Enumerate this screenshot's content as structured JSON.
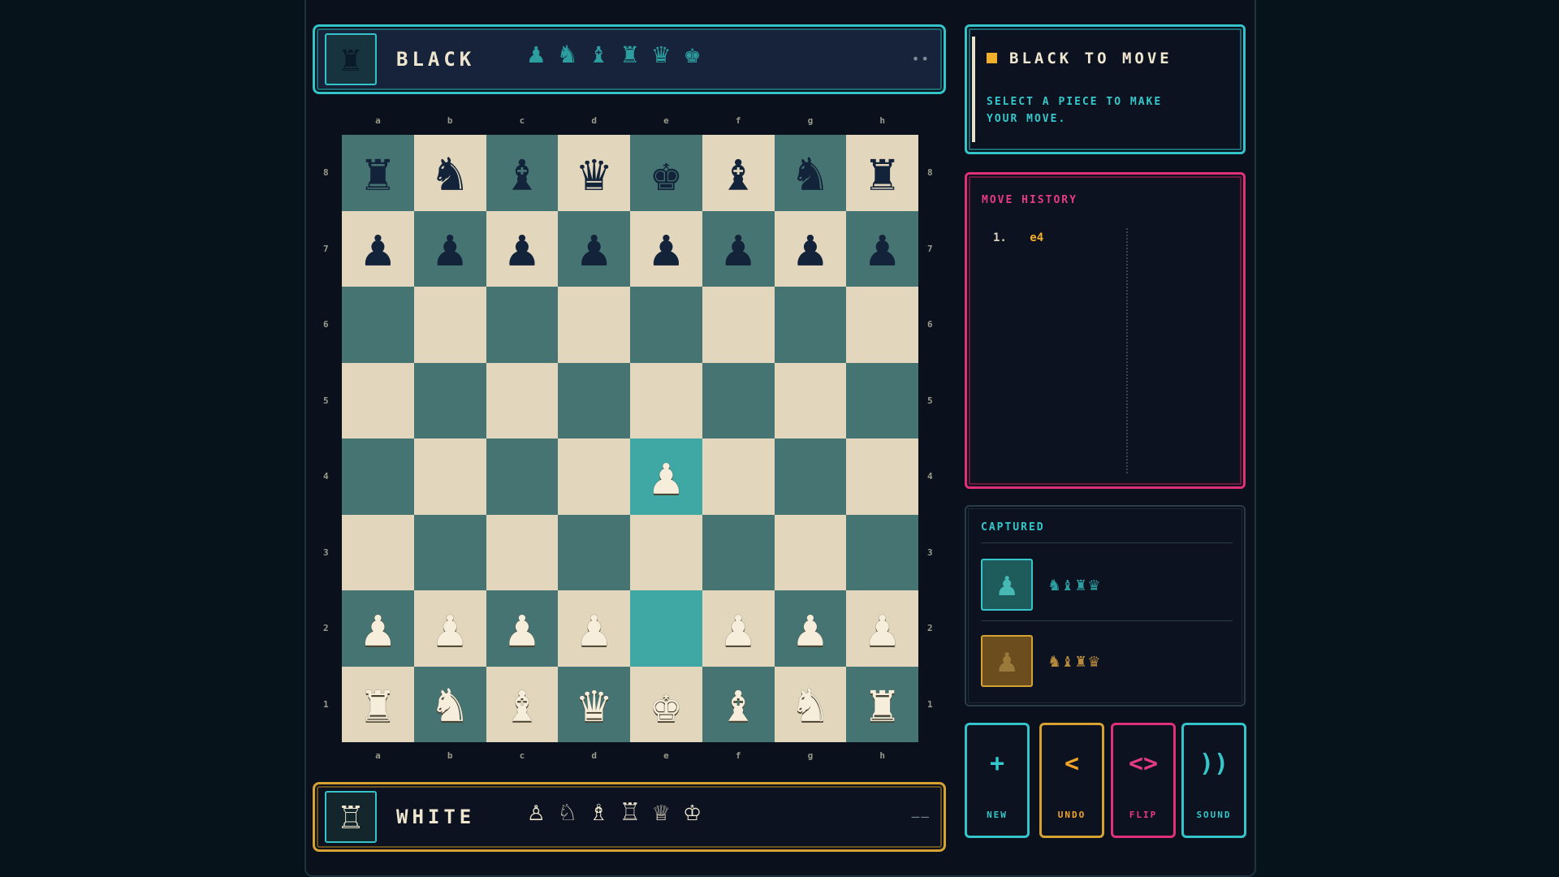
{
  "black_player": {
    "name": "BLACK",
    "avatar": "♜",
    "pieces": [
      "♟",
      "♞",
      "♝",
      "♜",
      "♛",
      "♚"
    ],
    "clock": "••"
  },
  "white_player": {
    "name": "WHITE",
    "avatar": "♖",
    "pieces": [
      "♙",
      "♘",
      "♗",
      "♖",
      "♕",
      "♔"
    ],
    "clock": "——"
  },
  "board": {
    "files": [
      "a",
      "b",
      "c",
      "d",
      "e",
      "f",
      "g",
      "h"
    ],
    "ranks": [
      "8",
      "7",
      "6",
      "5",
      "4",
      "3",
      "2",
      "1"
    ],
    "position": [
      [
        "r",
        "n",
        "b",
        "q",
        "k",
        "b",
        "n",
        "r"
      ],
      [
        "p",
        "p",
        "p",
        "p",
        "p",
        "p",
        "p",
        "p"
      ],
      [
        "",
        "",
        "",
        "",
        "",
        "",
        "",
        ""
      ],
      [
        "",
        "",
        "",
        "",
        "",
        "",
        "",
        ""
      ],
      [
        "",
        "",
        "",
        "",
        "P",
        "",
        "",
        ""
      ],
      [
        "",
        "",
        "",
        "",
        "",
        "",
        "",
        ""
      ],
      [
        "P",
        "P",
        "P",
        "P",
        "",
        "P",
        "P",
        "P"
      ],
      [
        "R",
        "N",
        "B",
        "Q",
        "K",
        "B",
        "N",
        "R"
      ]
    ],
    "last_move_squares": [
      "e2",
      "e4"
    ]
  },
  "status": {
    "title": "BLACK TO MOVE",
    "message": "SELECT A PIECE TO MAKE YOUR MOVE."
  },
  "history": {
    "title": "MOVE HISTORY",
    "moves": [
      {
        "num": "1.",
        "white": "e4",
        "black": ""
      }
    ]
  },
  "captured": {
    "title": "CAPTURED",
    "rows": [
      {
        "icon": "♟",
        "pieces": "♞♝♜♛"
      },
      {
        "icon": "♟",
        "pieces": "♞♝♜♛"
      }
    ]
  },
  "controls": {
    "new": {
      "label": "NEW",
      "icon": "+"
    },
    "undo": {
      "label": "UNDO",
      "icon": "<"
    },
    "flip": {
      "label": "FLIP",
      "icon": "<>"
    },
    "sound": {
      "label": "SOUND",
      "icon": "))"
    }
  },
  "colors": {
    "accent_teal": "#33c3c9",
    "accent_gold": "#d6a232",
    "accent_pink": "#e0307a",
    "square_light": "#e2d7bd",
    "square_dark": "#467473",
    "square_highlight": "#3fa7a4"
  }
}
